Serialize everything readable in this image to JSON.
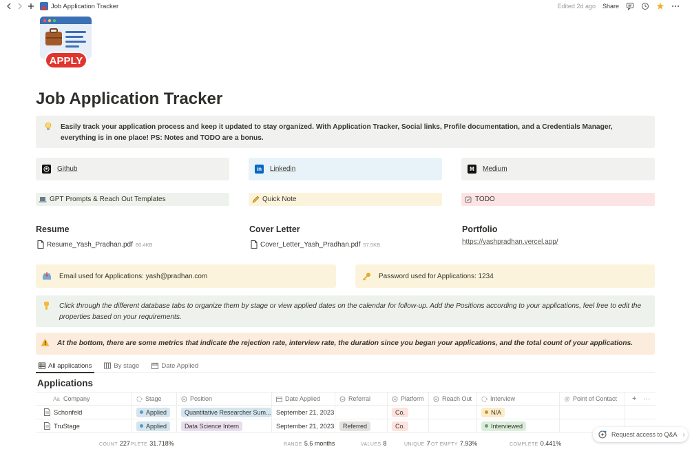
{
  "topbar": {
    "title": "Job Application Tracker",
    "edited": "Edited 2d ago",
    "share": "Share"
  },
  "page": {
    "title": "Job Application Tracker",
    "icon_label": "APPLY"
  },
  "intro": {
    "text": "Easily track your application process and keep it updated to stay organized. With Application Tracker, Social links, Profile documentation, and a Credentials Manager, everything is in one place! PS: Notes and TODO are a bonus."
  },
  "links": {
    "github": "Github",
    "linkedin": "Linkedin",
    "medium": "Medium"
  },
  "subpages": {
    "gpt": "GPT Prompts & Reach Out Templates",
    "quick_note": "Quick Note",
    "todo": "TODO"
  },
  "resume": {
    "heading": "Resume",
    "file": "Resume_Yash_Pradhan.pdf",
    "size": "80.4KB"
  },
  "cover_letter": {
    "heading": "Cover Letter",
    "file": "Cover_Letter_Yash_Pradhan.pdf",
    "size": "57.5KB"
  },
  "portfolio": {
    "heading": "Portfolio",
    "url": "https://yashpradhan.vercel.app/"
  },
  "credentials": {
    "email": "Email used for Applications: yash@pradhan.com",
    "password": "Password used for Applications: 1234"
  },
  "tips": {
    "green": "Click through the different database tabs to organize them by stage or view applied dates on the calendar for follow-up.  Add the Positions according to your applications, feel free to edit the properties based on your requirements.",
    "orange": "At the bottom, there are some metrics that indicate the rejection rate, interview rate, the duration since you began your applications, and the total count of your applications."
  },
  "tabs": {
    "all": "All applications",
    "stage": "By stage",
    "date": "Date Applied"
  },
  "database": {
    "title": "Applications",
    "headers": {
      "company": "Company",
      "stage": "Stage",
      "position": "Position",
      "date": "Date Applied",
      "referral": "Referral",
      "platform": "Platform",
      "reach": "Reach Out",
      "interview": "Interview",
      "poc": "Point of Contact"
    },
    "rows": [
      {
        "company": "Schonfeld",
        "stage": "Applied",
        "position": "Quantitative Researcher Sum...",
        "date": "September 21, 2023",
        "referral": "",
        "platform": "Co.",
        "interview": "N/A"
      },
      {
        "company": "TruStage",
        "stage": "Applied",
        "position": "Data Science Intern",
        "date": "September 21, 2023",
        "referral": "Referred",
        "platform": "Co.",
        "interview": "Interviewed"
      }
    ]
  },
  "footer": {
    "count_label": "COUNT",
    "count": "227",
    "complete_label": "PLETE",
    "complete": "31.718%",
    "range_label": "RANGE",
    "range": "5.6 months",
    "values_label": "VALUES",
    "values": "8",
    "unique_label": "UNIQUE",
    "unique": "7",
    "empty_label": "OT EMPTY",
    "empty": "7.93%",
    "complete2_label": "COMPLETE",
    "complete2": "0.441%"
  },
  "qa": {
    "label": "Request access to Q&A"
  },
  "colors": {
    "stage_applied_bg": "#d3e5ef",
    "stage_applied_dot": "#5b97bd",
    "position_blue": "#d3e5ef",
    "position_purple": "#e8deee",
    "referral_gray": "#e3e2e0",
    "platform_red": "#ffe2dd",
    "interview_na": "#fdecc8",
    "interview_done": "#dbeddb"
  }
}
